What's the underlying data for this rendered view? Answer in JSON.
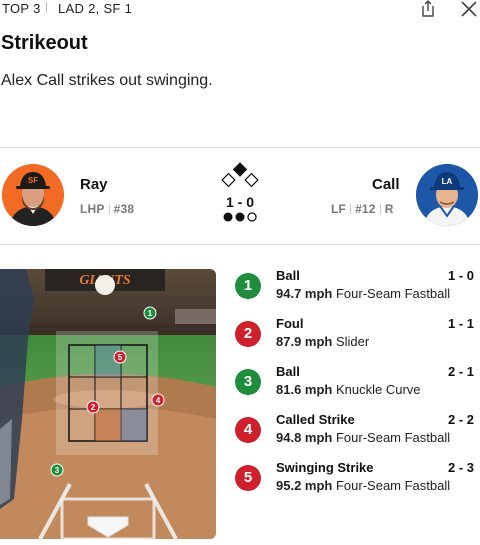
{
  "header": {
    "inning": "TOP 3",
    "score": "LAD 2, SF 1",
    "share_icon": "share-icon",
    "close_icon": "close-icon"
  },
  "play": {
    "title": "Strikeout",
    "description": "Alex Call strikes out swinging."
  },
  "matchup": {
    "pitcher": {
      "name": "Ray",
      "position": "LHP",
      "number": "#38",
      "avatar": "pitcher-headshot"
    },
    "batter": {
      "name": "Call",
      "position": "LF",
      "number": "#12",
      "bats": "R",
      "avatar": "batter-headshot"
    },
    "count": "1 - 0",
    "bases_occupied": [
      "second"
    ],
    "outs": 2
  },
  "pitches": [
    {
      "number": "1",
      "result": "Ball",
      "count": "1 - 0",
      "speed": "94.7 mph",
      "type": "Four-Seam Fastball",
      "color": "#1e8e3e"
    },
    {
      "number": "2",
      "result": "Foul",
      "count": "1 - 1",
      "speed": "87.9 mph",
      "type": "Slider",
      "color": "#d0202e"
    },
    {
      "number": "3",
      "result": "Ball",
      "count": "2 - 1",
      "speed": "81.6 mph",
      "type": "Knuckle Curve",
      "color": "#1e8e3e"
    },
    {
      "number": "4",
      "result": "Called Strike",
      "count": "2 - 2",
      "speed": "94.8 mph",
      "type": "Four-Seam Fastball",
      "color": "#d0202e"
    },
    {
      "number": "5",
      "result": "Swinging Strike",
      "count": "2 - 3",
      "speed": "95.2 mph",
      "type": "Four-Seam Fastball",
      "color": "#d0202e"
    }
  ],
  "colors": {
    "ball": "#1e8e3e",
    "strike": "#d0202e",
    "giants_orange": "#f26b24",
    "dodgers_blue": "#1f57a8"
  }
}
